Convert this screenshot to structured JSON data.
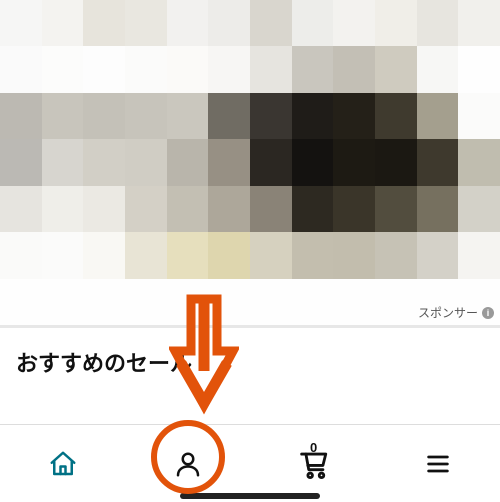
{
  "sponsor": {
    "label": "スポンサー"
  },
  "section": {
    "title": "おすすめのセール"
  },
  "nav": {
    "cart_count": "0"
  }
}
